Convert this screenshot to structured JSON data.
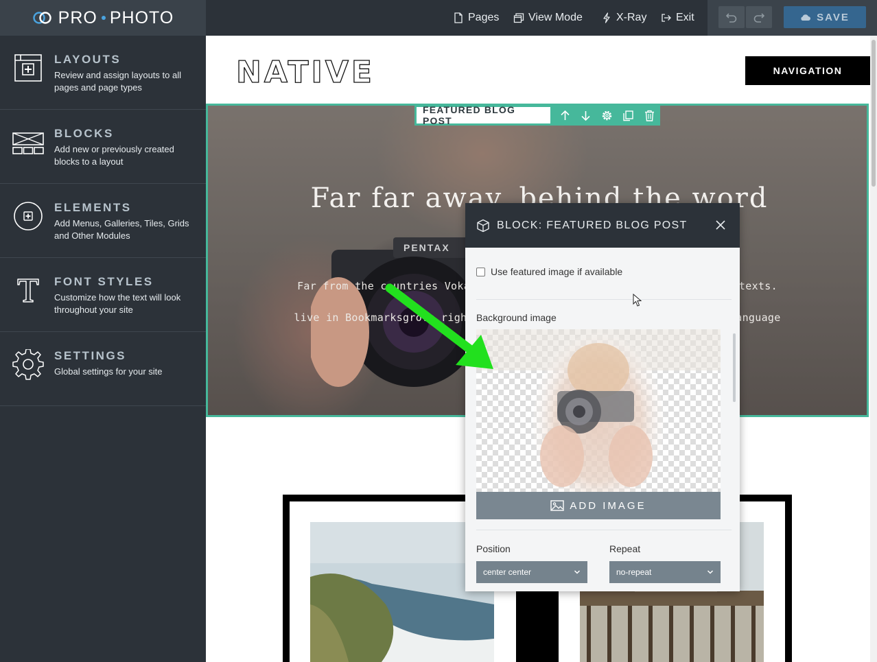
{
  "app": {
    "brand_pro": "PRO",
    "brand_photo": "PHOTO"
  },
  "topbar": {
    "links": [
      {
        "label": "Pages",
        "icon": "page-icon"
      },
      {
        "label": "View Mode",
        "icon": "view-mode-icon"
      },
      {
        "label": "X-Ray",
        "icon": "bolt-icon"
      },
      {
        "label": "Exit",
        "icon": "exit-icon"
      }
    ],
    "save_label": "SAVE"
  },
  "sidebar": {
    "items": [
      {
        "title": "LAYOUTS",
        "desc": "Review and assign layouts to all pages and page types",
        "icon": "layouts-icon"
      },
      {
        "title": "BLOCKS",
        "desc": "Add new or previously created blocks to a layout",
        "icon": "blocks-icon"
      },
      {
        "title": "ELEMENTS",
        "desc": "Add Menus, Galleries, Tiles, Grids and Other Modules",
        "icon": "elements-icon"
      },
      {
        "title": "FONT STYLES",
        "desc": "Customize how the text will look throughout your site",
        "icon": "font-styles-icon"
      },
      {
        "title": "SETTINGS",
        "desc": "Global settings for your site",
        "icon": "settings-icon"
      }
    ]
  },
  "canvas": {
    "site_logo": "NATIVE",
    "nav_label": "NAVIGATION",
    "block_label": "FEATURED BLOG POST",
    "hero_title": "Far far away, behind the word",
    "hero_text_line1": "Far from the countries Vokalia and Consonantia, there live the blind texts. Separated they",
    "hero_text_line2": "live in Bookmarksgrove right at the coast of the Semantics, a large language ocean."
  },
  "modal": {
    "title": "BLOCK: FEATURED BLOG POST",
    "featured_checkbox_label": "Use featured image if available",
    "featured_checked": false,
    "background_image_label": "Background image",
    "add_image_label": "ADD IMAGE",
    "position_label": "Position",
    "position_value": "center center",
    "repeat_label": "Repeat",
    "repeat_value": "no-repeat"
  },
  "colors": {
    "accent": "#46b89b",
    "dark": "#2c3239",
    "save_bg": "#35668f",
    "arrow": "#22e01e"
  }
}
